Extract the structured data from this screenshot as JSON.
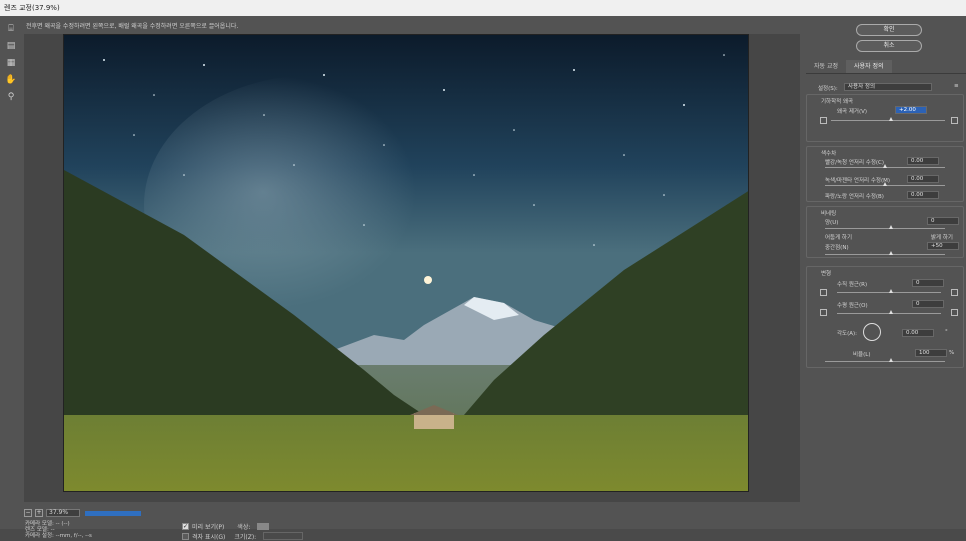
{
  "window": {
    "title": "렌즈 교정(37.9%)"
  },
  "hint": "전후면 왜곡을 수정하려면 왼쪽으로, 배럴 왜곡을 수정하려면 오른쪽으로 끌어옵니다.",
  "tools": [
    "remove-distortion-icon",
    "straighten-icon",
    "move-grid-icon",
    "hand-icon",
    "zoom-icon"
  ],
  "zoom": {
    "minus": "−",
    "plus": "+",
    "level": "37.9%"
  },
  "camera_info": {
    "line1": "카메라 모델: -- (--)",
    "line2": "렌즈 모델: --",
    "line3": "카메라 설정: --mm, f/--, --s"
  },
  "preview": {
    "checked_mark": "✓",
    "preview_label": "미리 보기(P)",
    "grid_label": "격자 표시(G)",
    "color_label": "색상:",
    "size_label": "크기(Z):"
  },
  "buttons": {
    "ok": "확인",
    "cancel": "취소"
  },
  "tabs": [
    "자동 교정",
    "사용자 정의"
  ],
  "settings": {
    "label": "설정(S):",
    "value": "사용자 정의"
  },
  "geometric": {
    "heading": "기하학적 왜곡",
    "remove_label": "왜곡 제거(V)",
    "remove_value": "+2.00"
  },
  "chromatic": {
    "heading": "색수차",
    "items": [
      {
        "label": "빨강/녹청 언저리 수정(C)",
        "value": "0.00"
      },
      {
        "label": "녹색/마젠타 언저리 수정(M)",
        "value": "0.00"
      },
      {
        "label": "파랑/노랑 언저리 수정(B)",
        "value": "0.00"
      }
    ]
  },
  "vignette": {
    "heading": "비네팅",
    "amount_label": "양(U)",
    "amount_value": "0",
    "darken": "어둡게 하기",
    "lighten": "밝게 하기",
    "midpoint_label": "중간점(N)",
    "midpoint_value": "+50"
  },
  "transform": {
    "heading": "변형",
    "vertical_label": "수직 원근(R)",
    "vertical_value": "0",
    "horizontal_label": "수평 원근(O)",
    "horizontal_value": "0",
    "angle_label": "각도(A):",
    "angle_value": "0.00",
    "angle_unit": "°",
    "scale_label": "비율(L)",
    "scale_value": "100",
    "scale_unit": "%"
  },
  "accent_color": "#2c62b5"
}
